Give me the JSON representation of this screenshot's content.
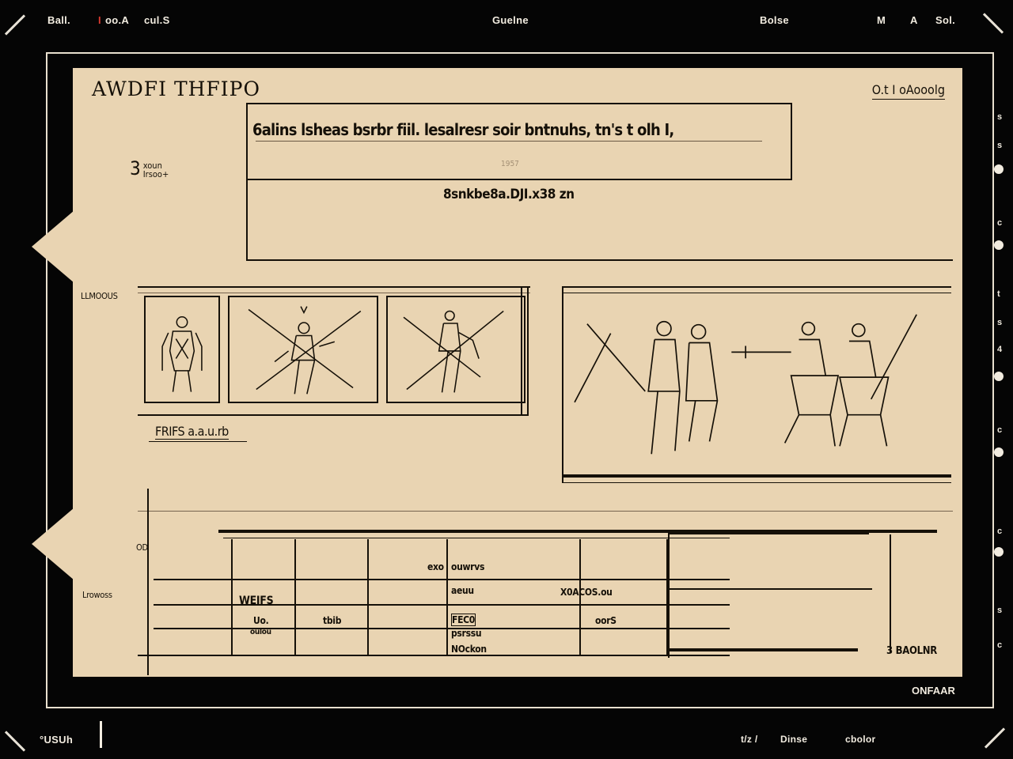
{
  "topbar": {
    "left_label": "Ball.",
    "menu": [
      {
        "label": "I",
        "accent": true
      },
      {
        "label": "oo.A"
      },
      {
        "label": "cul.S"
      }
    ],
    "center_title": "Guelne",
    "right": [
      "Bolse",
      "M",
      "A",
      "Sol."
    ]
  },
  "document": {
    "title": "AWDFI THFIPO",
    "top_right_link": "O.t I oAooolg",
    "quote": "6alins lsheas bsrbr fiil. lesalresr soir bntnuhs, tn's t olh I,",
    "quote_small": "1957",
    "caption": "8snkbe8a.DJI.x38 zn",
    "stepper_value": "3",
    "stepper_small": [
      "xoun",
      "Irsoo+"
    ],
    "side_label_figures": "LLMOOUS",
    "figures_caption": "FRIFS a.a.u.rb",
    "table_side_label_top": "OD",
    "table_side_label": "Lrowoss",
    "table_cells": {
      "c1a": "WEIFS",
      "c1b": "Uo.",
      "c1c": "oulou",
      "c2": "tbib",
      "c3a": "exo",
      "c3b": "ouwrvs",
      "c3c": "aeuu",
      "c3d": "FEC0",
      "c3e": "psrssu",
      "c3f": "NOckon",
      "c4a": "X0ACOS.ou",
      "c4b": "oorS"
    },
    "bottom_right_label": "3 BAOLNR"
  },
  "bottombar": {
    "left": "°USUh",
    "right": [
      "t/z /",
      "Dinse",
      "cbolor"
    ],
    "frame_label": "ONFAAR"
  },
  "scrollbar": {
    "ticks": [
      "s",
      "s",
      "c",
      "t",
      "s",
      "4",
      "c",
      "c",
      "s",
      "c"
    ]
  },
  "colors": {
    "background": "#050505",
    "paper": "#e9d4b2",
    "ink": "#151008",
    "accent": "#d8392f"
  }
}
